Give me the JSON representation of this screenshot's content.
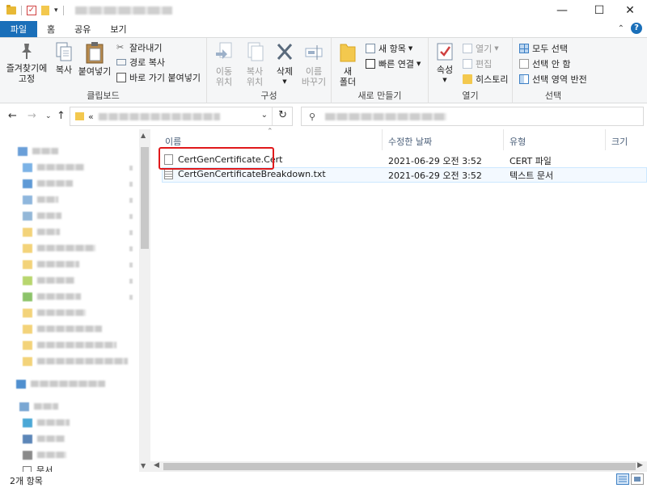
{
  "tabs": {
    "file": "파일",
    "home": "홈",
    "share": "공유",
    "view": "보기"
  },
  "ribbon": {
    "clipboard": {
      "label": "클립보드",
      "pin_line1": "즐겨찾기에",
      "pin_line2": "고정",
      "copy": "복사",
      "paste": "붙여넣기",
      "cut": "잘라내기",
      "copy_path": "경로 복사",
      "paste_shortcut": "바로 가기 붙여넣기"
    },
    "organize": {
      "label": "구성",
      "move_line1": "이동",
      "move_line2": "위치",
      "copyto_line1": "복사",
      "copyto_line2": "위치",
      "delete": "삭제",
      "rename_line1": "이름",
      "rename_line2": "바꾸기"
    },
    "new": {
      "label": "새로 만들기",
      "new_folder_line1": "새",
      "new_folder_line2": "폴더",
      "new_item": "새 항목",
      "easy_access": "빠른 연결"
    },
    "open": {
      "label": "열기",
      "properties": "속성",
      "open": "열기",
      "edit": "편집",
      "history": "히스토리"
    },
    "select": {
      "label": "선택",
      "select_all": "모두 선택",
      "select_none": "선택 안 함",
      "invert": "선택 영역 반전"
    }
  },
  "columns": {
    "name": "이름",
    "modified": "수정한 날짜",
    "type": "유형",
    "size": "크기"
  },
  "files": [
    {
      "name": "CertGenCertificate.Cert",
      "modified": "2021-06-29 오전 3:52",
      "type": "CERT 파일",
      "size": ""
    },
    {
      "name": "CertGenCertificateBreakdown.txt",
      "modified": "2021-06-29 오전 3:52",
      "type": "텍스트 문서",
      "size": ""
    }
  ],
  "nav": {
    "documents": "문서"
  },
  "status": {
    "count": "2개 항목"
  },
  "colors": {
    "accent": "#1a6fb9",
    "highlight_box": "#e0191b",
    "header_text": "#4c607a"
  }
}
